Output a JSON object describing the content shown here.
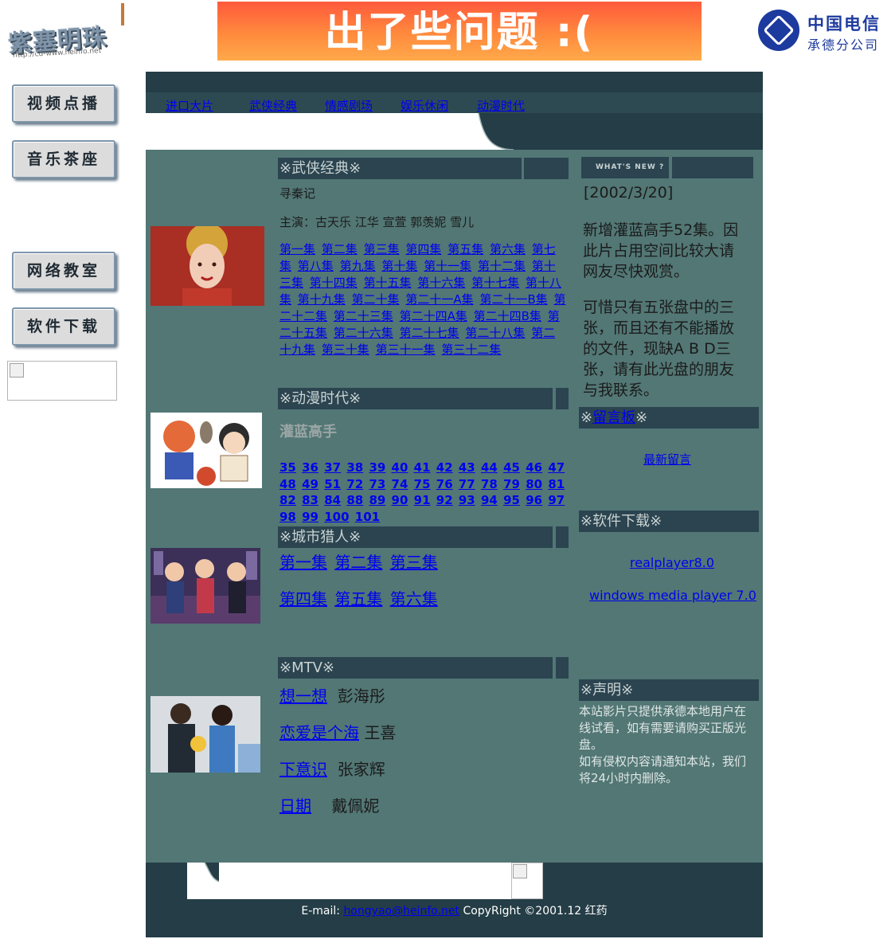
{
  "header": {
    "logo_text": "紫塞明珠",
    "logo_url": "http://cd-www.heinfo.net",
    "banner_text": "出了些问题 :(",
    "telecom_name": "中国电信",
    "telecom_branch": "承德分公司"
  },
  "left_nav": [
    {
      "label": "视频点播"
    },
    {
      "label": "音乐茶座"
    },
    {
      "label": "网络教室"
    },
    {
      "label": "软件下载"
    }
  ],
  "tabs": [
    "进口大片",
    "武侠经典",
    "情感剧场",
    "娱乐休闲",
    "动漫时代"
  ],
  "wuxia": {
    "header": "※武侠经典※",
    "title": "寻秦记",
    "cast": "主演：古天乐 江华 宣萱 郭羡妮 雪儿",
    "episodes": [
      "第一集",
      "第二集",
      "第三集",
      "第四集",
      "第五集",
      "第六集",
      "第七集",
      "第八集",
      "第九集",
      "第十集",
      "第十一集",
      "第十二集",
      "第十三集",
      "第十四集",
      "第十五集",
      "第十六集",
      "第十七集",
      "第十八集",
      "第十九集",
      "第二十集",
      "第二十一A集",
      "第二十一B集",
      "第二十二集",
      "第二十三集",
      "第二十四A集",
      "第二十四B集",
      "第二十五集",
      "第二十六集",
      "第二十七集",
      "第二十八集",
      "第二十九集",
      "第三十集",
      "第三十一集",
      "第三十二集"
    ]
  },
  "anime": {
    "header": "※动漫时代※",
    "title": "灌蓝高手",
    "episodes": [
      "35",
      "36",
      "37",
      "38",
      "39",
      "40",
      "41",
      "42",
      "43",
      "44",
      "45",
      "46",
      "47",
      "48",
      "49",
      "51",
      "72",
      "73",
      "74",
      "75",
      "76",
      "77",
      "78",
      "79",
      "80",
      "81",
      "82",
      "83",
      "84",
      "88",
      "89",
      "90",
      "91",
      "92",
      "93",
      "94",
      "95",
      "96",
      "97",
      "98",
      "99",
      "100",
      "101"
    ]
  },
  "city_hunter": {
    "header": "※城市猎人※",
    "row1": [
      "第一集",
      "第二集",
      "第三集"
    ],
    "row2": [
      "第四集",
      "第五集",
      "第六集"
    ]
  },
  "mtv": {
    "header": "※MTV※",
    "songs": [
      {
        "title": "想一想",
        "artist": "彭海彤"
      },
      {
        "title": "恋爱是个海",
        "artist": "王喜"
      },
      {
        "title": "下意识",
        "artist": "张家辉"
      },
      {
        "title": "日期",
        "artist": "戴佩妮"
      }
    ]
  },
  "news": {
    "header_badge": "WHAT'S NEW ?",
    "date": "[2002/3/20]",
    "para1": "新增灌蓝高手52集。因此片占用空间比较大请网友尽快观赏。",
    "para2": "可惜只有五张盘中的三张，而且还有不能播放的文件，现缺A B D三张，请有此光盘的朋友与我联系。"
  },
  "guestbook": {
    "prefix": "※",
    "link": "留言板",
    "suffix": "※",
    "latest": "最新留言"
  },
  "software": {
    "header": "※软件下载※",
    "items": [
      "realplayer8.0",
      "windows media player 7.0"
    ]
  },
  "statement": {
    "header": "※声明※",
    "text1": "本站影片只提供承德本地用户在线试看，如有需要请购买正版光盘。",
    "text2": "如有侵权内容请通知本站，我们将24小时内删除。"
  },
  "footer": {
    "email_label": "E-mail:",
    "email": "hongyao@heinfo.net",
    "copyright": "CopyRight ©2001.12  红药"
  }
}
